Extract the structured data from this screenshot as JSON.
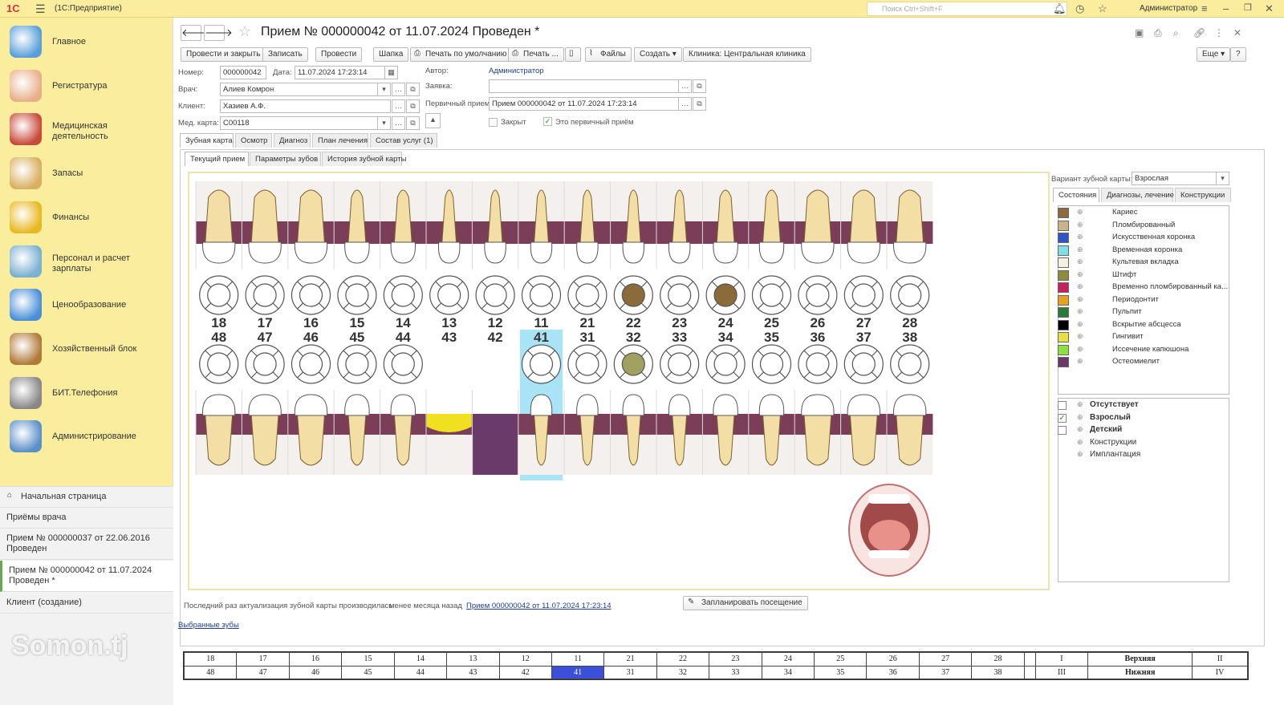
{
  "topbar": {
    "logo": "1С",
    "app_title": "(1С:Предприятие)",
    "search_placeholder": "Поиск Ctrl+Shift+F",
    "user": "Администратор"
  },
  "sidebar": {
    "sections": [
      {
        "label": "Главное",
        "icon": "home-icon"
      },
      {
        "label": "Регистратура",
        "icon": "nurse-icon"
      },
      {
        "label": "Медицинская деятельность",
        "icon": "medical-kit-icon"
      },
      {
        "label": "Запасы",
        "icon": "boxes-icon"
      },
      {
        "label": "Финансы",
        "icon": "coins-icon"
      },
      {
        "label": "Персонал и расчет зарплаты",
        "icon": "staff-icon"
      },
      {
        "label": "Ценообразование",
        "icon": "price-chart-icon"
      },
      {
        "label": "Хозяйственный блок",
        "icon": "toolbox-icon"
      },
      {
        "label": "БИТ.Телефония",
        "icon": "phone-icon"
      },
      {
        "label": "Администрирование",
        "icon": "admin-computer-icon"
      }
    ],
    "nav": [
      "Начальная страница",
      "Приёмы врача",
      "Прием № 000000037 от 22.06.2016 Проведен",
      "Прием № 000000042 от 11.07.2024 Проведен *",
      "Клиент (создание)"
    ]
  },
  "doc": {
    "title": "Прием № 000000042 от 11.07.2024 Проведен *"
  },
  "toolbar": {
    "post_close": "Провести и закрыть",
    "write": "Записать",
    "post": "Провести",
    "header": "Шапка",
    "print_default": "Печать по умолчанию",
    "print": "Печать ...",
    "files": "Файлы",
    "create": "Создать",
    "clinic": "Клиника: Центральная клиника",
    "more": "Еще",
    "help": "?"
  },
  "form": {
    "number_label": "Номер:",
    "number": "000000042",
    "date_label": "Дата:",
    "date": "11.07.2024 17:23:14",
    "author_label": "Автор:",
    "author": "Администратор",
    "doctor_label": "Врач:",
    "doctor": "Алиев Комрон",
    "request_label": "Заявка:",
    "request": "",
    "client_label": "Клиент:",
    "client": "Хазиев А.Ф.",
    "primary_label": "Первичный прием:",
    "primary": "Прием 000000042 от 11.07.2024 17:23:14",
    "card_label": "Мед. карта:",
    "card": "С00118",
    "closed_label": "Закрыт",
    "is_primary_label": "Это первичный приём"
  },
  "tabs": [
    "Зубная карта",
    "Осмотр",
    "Диагноз",
    "План лечения",
    "Состав услуг (1)"
  ],
  "subtabs": [
    "Текущий прием",
    "Параметры зубов",
    "История зубной карты"
  ],
  "variant": {
    "label": "Вариант зубной карты:",
    "value": "Взрослая"
  },
  "right_tabs": [
    "Состояния",
    "Диагнозы, лечение",
    "Конструкции"
  ],
  "legend": [
    {
      "name": "Кариес",
      "color": "#8b6b3a"
    },
    {
      "name": "Пломбированный",
      "color": "#c9b48a"
    },
    {
      "name": "Искусственная коронка",
      "color": "#2d55c8"
    },
    {
      "name": "Временная коронка",
      "color": "#7ee0e6"
    },
    {
      "name": "Культевая вкладка",
      "color": "#f4f0e0"
    },
    {
      "name": "Штифт",
      "color": "#8c8c3a"
    },
    {
      "name": "Временно пломбированный ка...",
      "color": "#c8205a"
    },
    {
      "name": "Периодонтит",
      "color": "#e8a020"
    },
    {
      "name": "Пульпит",
      "color": "#2c7a3a"
    },
    {
      "name": "Вскрытие абсцесса",
      "color": "#000000"
    },
    {
      "name": "Гингивит",
      "color": "#e8e040"
    },
    {
      "name": "Иссечение капюшона",
      "color": "#8ee03a"
    },
    {
      "name": "Остеомиелит",
      "color": "#6a3a6a"
    }
  ],
  "toggles": [
    {
      "name": "Отсутствует",
      "checked": false,
      "bold": true
    },
    {
      "name": "Взрослый",
      "checked": true,
      "bold": true
    },
    {
      "name": "Детский",
      "checked": false,
      "bold": true
    },
    {
      "name": "Конструкции",
      "checked": null,
      "bold": false
    },
    {
      "name": "Имплантация",
      "checked": null,
      "bold": false
    }
  ],
  "teeth": {
    "upper": [
      "18",
      "17",
      "16",
      "15",
      "14",
      "13",
      "12",
      "11",
      "21",
      "22",
      "23",
      "24",
      "25",
      "26",
      "27",
      "28"
    ],
    "lower": [
      "48",
      "47",
      "46",
      "45",
      "44",
      "43",
      "42",
      "41",
      "31",
      "32",
      "33",
      "34",
      "35",
      "36",
      "37",
      "38"
    ],
    "upper_circle_fill": {
      "22": "#8b6b3a",
      "24": "#8b6b3a"
    },
    "lower_circle_fill": {
      "32": "#a0a060"
    },
    "lower_no_circle": [
      "43",
      "42"
    ],
    "selected": "41"
  },
  "footer": {
    "actualized_text": "Последний раз актуализация зубной карты производилась:",
    "actualized_when": "менее месяца назад",
    "actualized_link": "Прием 000000042 от 11.07.2024 17:23:14",
    "schedule": "Запланировать посещение",
    "selected_teeth": "Выбранные зубы"
  },
  "bottom_table": {
    "row1": [
      "18",
      "17",
      "16",
      "15",
      "14",
      "13",
      "12",
      "11",
      "21",
      "22",
      "23",
      "24",
      "25",
      "26",
      "27",
      "28",
      "",
      "I",
      "Верхняя",
      "II"
    ],
    "row2": [
      "48",
      "47",
      "46",
      "45",
      "44",
      "43",
      "42",
      "41",
      "31",
      "32",
      "33",
      "34",
      "35",
      "36",
      "37",
      "38",
      "",
      "III",
      "Нижняя",
      "IV"
    ]
  },
  "watermark": "Somon.tj"
}
